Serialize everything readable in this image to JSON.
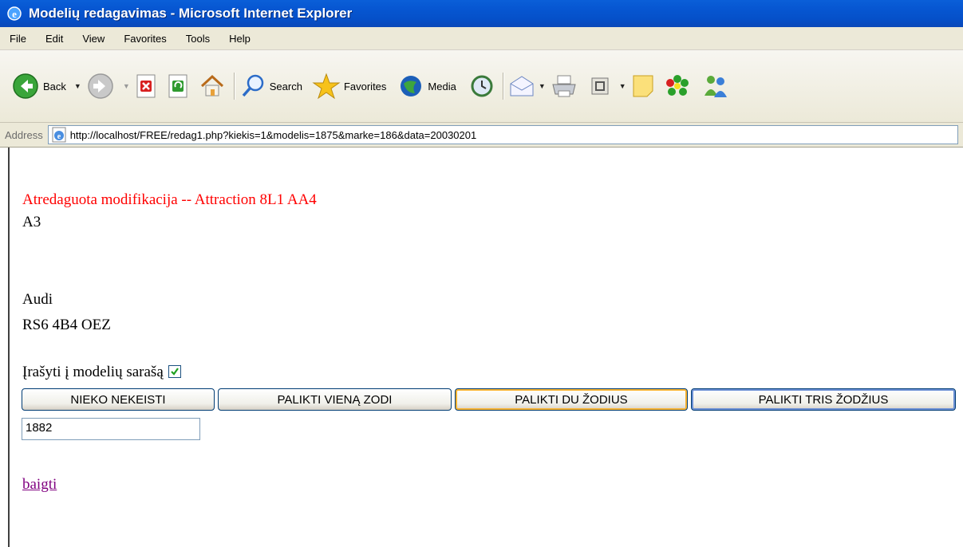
{
  "window": {
    "title": "Modelių redagavimas - Microsoft Internet Explorer"
  },
  "menu": [
    "File",
    "Edit",
    "View",
    "Favorites",
    "Tools",
    "Help"
  ],
  "toolbar": {
    "back_label": "Back",
    "search_label": "Search",
    "favorites_label": "Favorites",
    "media_label": "Media"
  },
  "address": {
    "label": "Address",
    "url": "http://localhost/FREE/redag1.php?kiekis=1&modelis=1875&marke=186&data=20030201"
  },
  "content": {
    "status_message": "Atredaguota modifikacija -- Attraction 8L1 AA4",
    "model": "A3",
    "brand": "Audi",
    "modification": "RS6 4B4 OEZ",
    "checkbox_label": "Įrašyti į modelių sarašą",
    "checkbox_checked": true,
    "buttons": {
      "b1": "NIEKO NEKEISTI",
      "b2": "PALIKTI VIENĄ ZODI",
      "b3": "PALIKTI DU ŽODIUS",
      "b4": "PALIKTI TRIS ŽODŽIUS"
    },
    "input_value": "1882",
    "finish_link": "baigti"
  },
  "colors": {
    "titlebar": "#0757d2",
    "status_text": "#ff0000",
    "visited_link": "#800080",
    "focus_outline": "#f8b332"
  }
}
